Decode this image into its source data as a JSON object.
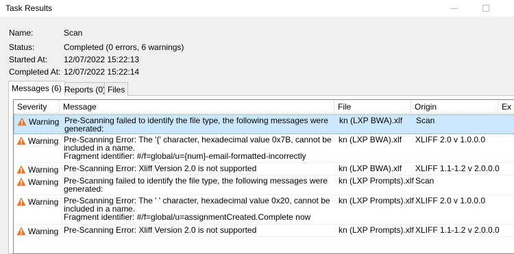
{
  "window": {
    "title": "Task Results"
  },
  "info": {
    "name_label": "Name:",
    "name_value": "Scan",
    "status_label": "Status:",
    "status_value": "Completed (0 errors, 6 warnings)",
    "started_label": "Started At:",
    "started_value": "12/07/2022 15:22:13",
    "completed_label": "Completed At:",
    "completed_value": "12/07/2022 15:22:14"
  },
  "tabs": [
    {
      "label": "Messages (6)",
      "active": true
    },
    {
      "label": "Reports (0)",
      "active": false
    },
    {
      "label": "Files",
      "active": false
    }
  ],
  "columns": [
    "Severity",
    "Message",
    "File",
    "Origin",
    "Ex"
  ],
  "rows": [
    {
      "severity": "Warning",
      "message": [
        "Pre-Scanning failed to identify the file type, the following messages were",
        "generated:"
      ],
      "file": "kn (LXP BWA).xlf",
      "origin": "Scan",
      "selected": true
    },
    {
      "severity": "Warning",
      "message": [
        "Pre-Scanning Error: The '{' character, hexadecimal value 0x7B, cannot be",
        "included in a name.",
        "Fragment identifier: #/f=global/u={num}-email-formatted-incorrectly"
      ],
      "file": "kn (LXP BWA).xlf",
      "origin": "XLIFF 2.0 v 1.0.0.0",
      "selected": false
    },
    {
      "severity": "Warning",
      "message": [
        "Pre-Scanning Error: Xliff Version 2.0 is not supported"
      ],
      "file": "kn (LXP BWA).xlf",
      "origin": "XLIFF 1.1-1.2 v 2.0.0.0",
      "selected": false
    },
    {
      "severity": "Warning",
      "message": [
        "Pre-Scanning failed to identify the file type, the following messages were",
        "generated:"
      ],
      "file": "kn (LXP Prompts).xlf",
      "origin": "Scan",
      "selected": false
    },
    {
      "severity": "Warning",
      "message": [
        "Pre-Scanning Error: The ' ' character, hexadecimal value 0x20, cannot be",
        "included in a name.",
        "Fragment identifier: #/f=global/u=assignmentCreated.Complete now"
      ],
      "file": "kn (LXP Prompts).xlf",
      "origin": "XLIFF 2.0 v 1.0.0.0",
      "selected": false
    },
    {
      "severity": "Warning",
      "message": [
        "Pre-Scanning Error: Xliff Version 2.0 is not supported"
      ],
      "file": "kn (LXP Prompts).xlf",
      "origin": "XLIFF 1.1-1.2 v 2.0.0.0",
      "selected": false
    }
  ],
  "colors": {
    "warning_icon": "#e8772e",
    "selected_row": "#cce8ff",
    "background": "#f0f0f0"
  }
}
